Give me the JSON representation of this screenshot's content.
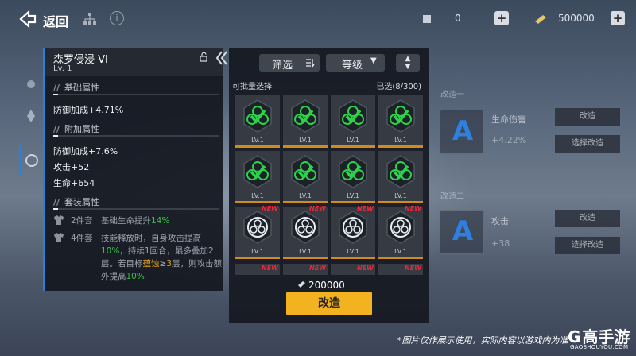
{
  "topbar": {
    "back_label": "返回",
    "resource_1": "0",
    "resource_2": "500000",
    "plus": "+",
    "info_symbol": "i"
  },
  "detail": {
    "name": "森罗侵浸 VI",
    "level": "Lv. 1",
    "sections": {
      "base": "基础属性",
      "extra": "附加属性",
      "set": "套装属性"
    },
    "base_stats": [
      "防御加成+4.71%"
    ],
    "extra_stats": [
      "防御加成+7.6%",
      "攻击+52",
      "生命+654"
    ],
    "set_bonus": [
      {
        "count": "2件套",
        "pre": "基础生命提升",
        "hl": "14%"
      },
      {
        "count": "4件套",
        "p1": "技能释放时，自身攻击提高",
        "h1": "10%",
        "p2": "，持续1回合，最多叠加2层。若目标",
        "h2": "蕴蚀",
        "p3": "≥",
        "h3": "3",
        "p4": "层，则攻击额外提高",
        "h4": "10%"
      }
    ]
  },
  "inventory": {
    "filter_label": "筛选",
    "sort_label": "等级",
    "sort_arrow": "▼",
    "order_up": "▲",
    "order_down": "▼",
    "batch_label": "可批量选择",
    "selected_count": "已选(8/300)",
    "card_level": "LV.1",
    "new_tag": "NEW",
    "cost": "200000",
    "modify_button": "改造"
  },
  "background_slots": {
    "slot1_label": "改造一",
    "slot1_text": "生命伤害",
    "slot1_value": "+4.22%",
    "slot2_label": "改造二",
    "slot2_text": "攻击",
    "slot2_value": "+38",
    "slot_letter": "A",
    "btn_modify": "改造",
    "btn_select": "选择改造"
  },
  "footnote": "*图片仅作展示使用，实际内容以游戏内为准",
  "watermark": {
    "logo": "高手游",
    "url": "GAOSHOUYOU.COM"
  },
  "colors": {
    "accent_blue": "#2f7fd8",
    "green": "#39c04a",
    "orange": "#e8a21d",
    "gold_button": "#f3b320",
    "new_red": "#e8283a"
  }
}
